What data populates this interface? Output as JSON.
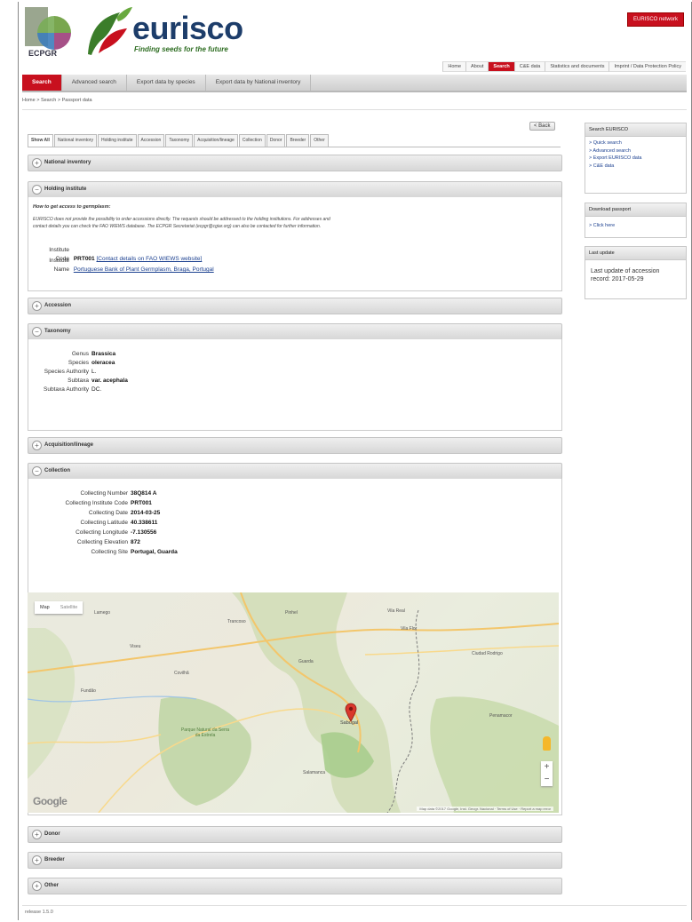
{
  "header": {
    "ecpgr_text": "ECPGR",
    "logo_name": "eurisco",
    "logo_tagline": "Finding seeds for the future",
    "network_button": "EURISCO network",
    "topnav": [
      "Home",
      "About",
      "Search",
      "C&E data",
      "Statistics and documents",
      "Imprint / Data Protection Policy"
    ],
    "topnav_active": "Search"
  },
  "mainnav": [
    "Search",
    "Advanced search",
    "Export data by species",
    "Export data by National inventory"
  ],
  "breadcrumb": "Home > Search > Passport data",
  "back_label": "< Back",
  "tabs": [
    "Show All",
    "National inventory",
    "Holding institute",
    "Accession",
    "Taxonomy",
    "Acquisition/lineage",
    "Collection",
    "Donor",
    "Breeder",
    "Other"
  ],
  "sections": {
    "national_inventory": "National inventory",
    "holding_institute": "Holding institute",
    "accession": "Accession",
    "taxonomy": "Taxonomy",
    "acquisition": "Acquisition/lineage",
    "collection": "Collection",
    "donor": "Donor",
    "breeder": "Breeder",
    "other": "Other"
  },
  "holding": {
    "heading": "How to get access to germplasm:",
    "note_line1": "EURISCO does not provide the possibility to order accessions directly. The requests should be addressed to the holding institutions. For addresses and",
    "note_line2": "contact details you can check the FAO WIEWS database. The ECPGR Secretariat (ecpgr@cgiar.org) can also be contacted for further information.",
    "code_label": "Institute Code",
    "code_value": "PRT001",
    "code_link": "[Contact details on FAO WIEWS website]",
    "name_label": "Institute Name",
    "name_value": "Portuguese Bank of Plant Germplasm, Braga, Portugal"
  },
  "taxonomy": {
    "rows": [
      {
        "k": "Genus",
        "v": "Brassica"
      },
      {
        "k": "Species",
        "v": "oleracea"
      },
      {
        "k": "Species Authority",
        "v": "L."
      },
      {
        "k": "Subtaxa",
        "v": "var. acephala"
      },
      {
        "k": "Subtaxa Authority",
        "v": "DC."
      }
    ]
  },
  "collection": {
    "rows": [
      {
        "k": "Collecting Number",
        "v": "38Q814 A"
      },
      {
        "k": "Collecting Institute Code",
        "v": "PRT001"
      },
      {
        "k": "Collecting Date",
        "v": "2014-03-25"
      },
      {
        "k": "Collecting Latitude",
        "v": "40.338611"
      },
      {
        "k": "Collecting Longitude",
        "v": "-7.130556"
      },
      {
        "k": "Collecting Elevation",
        "v": "872"
      },
      {
        "k": "Collecting Site",
        "v": "Portugal, Guarda"
      }
    ]
  },
  "map": {
    "type_map": "Map",
    "type_satellite": "Satellite",
    "google": "Google",
    "attribution": "Map data ©2017 Google, Inst. Geogr. Nacional · Terms of Use · Report a map error",
    "zoom_in": "+",
    "zoom_out": "−",
    "labels": [
      "Vila Real",
      "Viseu",
      "Guarda",
      "Sabugal",
      "Ciudad Rodrigo",
      "Fundão",
      "Covilhã",
      "Salamanca",
      "Parque Natural da Serra da Estrela",
      "Penamacor",
      "Vila Flor",
      "Pinhel",
      "Trancoso",
      "Lamego"
    ]
  },
  "sidebar": {
    "search_head": "Search EURISCO",
    "search_items": [
      "> Quick search",
      "> Advanced search",
      "> Export EURISCO data",
      "> C&E data"
    ],
    "download_head": "Download passport",
    "download_items": [
      "> Click here"
    ],
    "update_head": "Last update",
    "update_text": "Last update of accession record: 2017-05-29"
  },
  "footer": {
    "version": "release 1.5.0"
  }
}
